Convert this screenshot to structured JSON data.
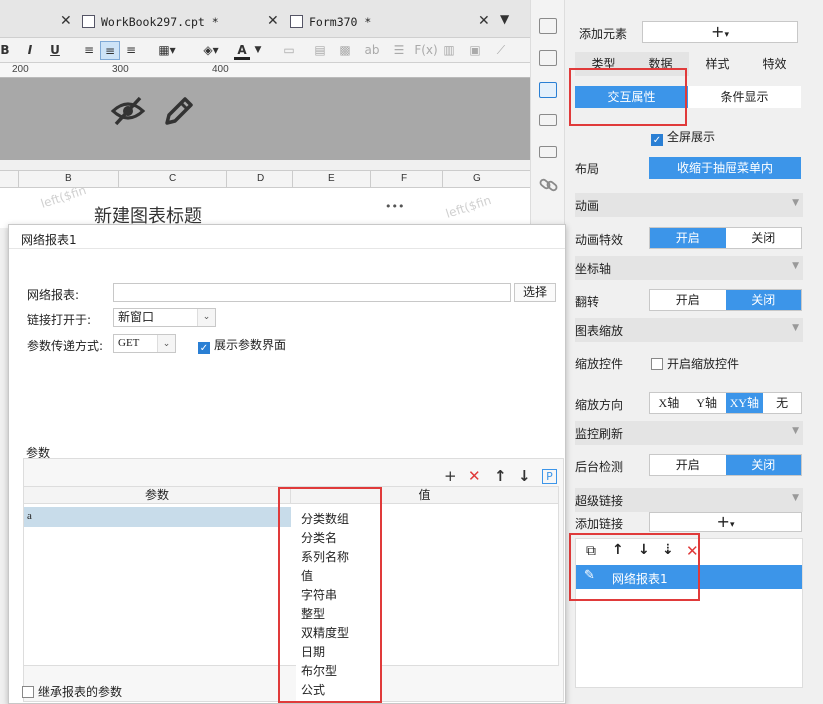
{
  "tabs": [
    {
      "label": "WorkBook297.cpt *",
      "close": "✕"
    },
    {
      "label": "Form370 *",
      "close": "✕"
    }
  ],
  "toolbar": {
    "bold": "B",
    "italic": "I",
    "underline": "U",
    "text_color_label": "A",
    "ab": "ab",
    "fx": "F(x)"
  },
  "ruler": [
    "200",
    "300",
    "400"
  ],
  "columns": [
    "B",
    "C",
    "D",
    "E",
    "F",
    "G"
  ],
  "canvas": {
    "chart_title": "新建图表标题",
    "more": "•••",
    "watermark": "left($fin"
  },
  "right_panel": {
    "add_element_label": "添加元素",
    "add_symbol": "+",
    "tabs": [
      "类型",
      "数据",
      "样式",
      "特效"
    ],
    "active_tab": "特效",
    "sub_tabs": [
      "交互属性",
      "条件显示"
    ],
    "fullscreen_label": "全屏展示",
    "layout_label": "布局",
    "layout_value": "收缩于抽屉菜单内",
    "sections": {
      "animation": "动画",
      "animation_effect": "动画特效",
      "axis": "坐标轴",
      "flip": "翻转",
      "zoom": "图表缩放",
      "zoom_control": "缩放控件",
      "zoom_enable": "开启缩放控件",
      "zoom_direction": "缩放方向",
      "monitor": "监控刷新",
      "bg_check": "后台检测",
      "hyperlink": "超级链接",
      "add_link": "添加链接"
    },
    "on_off": [
      "开启",
      "关闭"
    ],
    "zoom_dirs": [
      "X轴",
      "Y轴",
      "XY轴",
      "无"
    ],
    "link_item": "网络报表1"
  },
  "dialog": {
    "title": "网络报表1",
    "report_label": "网络报表:",
    "report_value": "",
    "choose_btn": "选择",
    "open_in_label": "链接打开于:",
    "open_in_value": "新窗口",
    "method_label": "参数传递方式:",
    "method_value": "GET",
    "show_param_label": "展示参数界面",
    "params_label": "参数",
    "col_param": "参数",
    "col_value": "值",
    "row_param": "a",
    "inherit_label": "继承报表的参数",
    "dropdown_items": [
      "分类数组",
      "分类名",
      "系列名称",
      "值",
      "字符串",
      "整型",
      "双精度型",
      "日期",
      "布尔型",
      "公式"
    ]
  }
}
